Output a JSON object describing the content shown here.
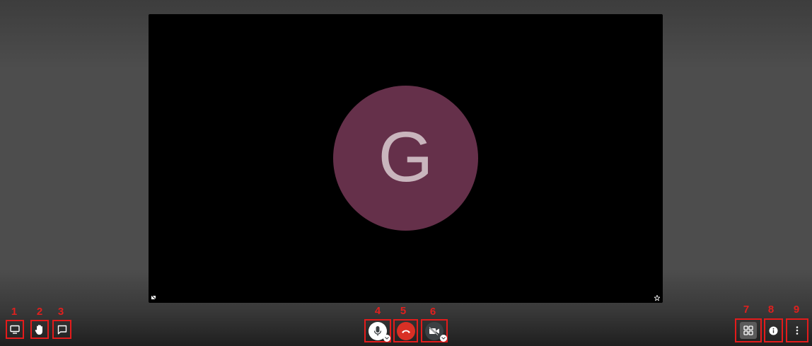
{
  "meeting": {
    "participant_initial": "G",
    "avatar_color": "#65304a",
    "tile_icons": [
      "mic-off-icon",
      "pin-icon"
    ]
  },
  "toolbar": {
    "markers": [
      "1",
      "2",
      "3",
      "4",
      "5",
      "6",
      "7",
      "8",
      "9"
    ],
    "left_buttons": [
      {
        "icon": "screen-share-icon"
      },
      {
        "icon": "raise-hand-icon"
      },
      {
        "icon": "chat-icon"
      }
    ],
    "center_buttons": [
      {
        "icon": "microphone-icon",
        "color": "#ffffff"
      },
      {
        "icon": "hang-up-icon",
        "color": "#d93025"
      },
      {
        "icon": "camera-off-icon",
        "color": "#3c4043"
      }
    ],
    "right_buttons": [
      {
        "icon": "tile-view-icon"
      },
      {
        "icon": "info-icon"
      },
      {
        "icon": "more-options-icon"
      }
    ]
  }
}
